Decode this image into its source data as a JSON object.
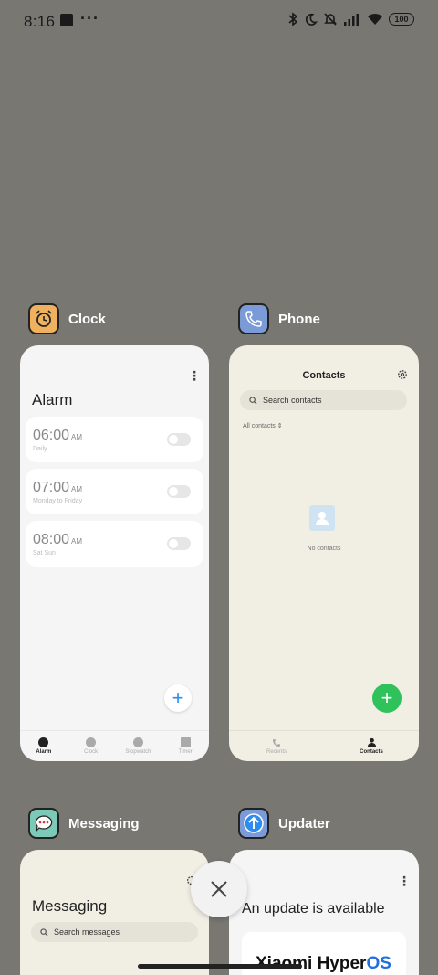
{
  "status_bar": {
    "time": "8:16",
    "more": "···",
    "battery": "100"
  },
  "apps": [
    {
      "name": "Clock",
      "screen_title": "Alarm",
      "alarms": [
        {
          "time": "06:00",
          "ampm": "AM",
          "repeat": "Daily"
        },
        {
          "time": "07:00",
          "ampm": "AM",
          "repeat": "Monday to Friday"
        },
        {
          "time": "08:00",
          "ampm": "AM",
          "repeat": "Sat Sun"
        }
      ],
      "tabs": [
        "Alarm",
        "Clock",
        "Stopwatch",
        "Timer"
      ],
      "active_tab": "Alarm"
    },
    {
      "name": "Phone",
      "screen_title": "Contacts",
      "search_placeholder": "Search contacts",
      "filter": "All contacts",
      "empty_text": "No contacts",
      "tabs": [
        "Recents",
        "Contacts"
      ],
      "active_tab": "Contacts"
    },
    {
      "name": "Messaging",
      "screen_title": "Messaging",
      "search_placeholder": "Search messages"
    },
    {
      "name": "Updater",
      "screen_title": "An update is available",
      "brand": "Xiaomi Hyper",
      "brand_accent": "OS"
    }
  ],
  "colors": {
    "background": "#787772",
    "clock_icon": "#f0b15e",
    "phone_icon": "#7a9bd8",
    "messaging_icon": "#7cc9b8",
    "updater_icon": "#7a9bd8",
    "fab_green": "#2fc25b",
    "fab_blue": "#2d8cf0",
    "hyperos_accent": "#1f6fe0"
  },
  "icons": [
    "bluetooth-icon",
    "moon-icon",
    "bell-off-icon",
    "signal-icon",
    "wifi-icon",
    "battery-icon",
    "close-icon"
  ]
}
